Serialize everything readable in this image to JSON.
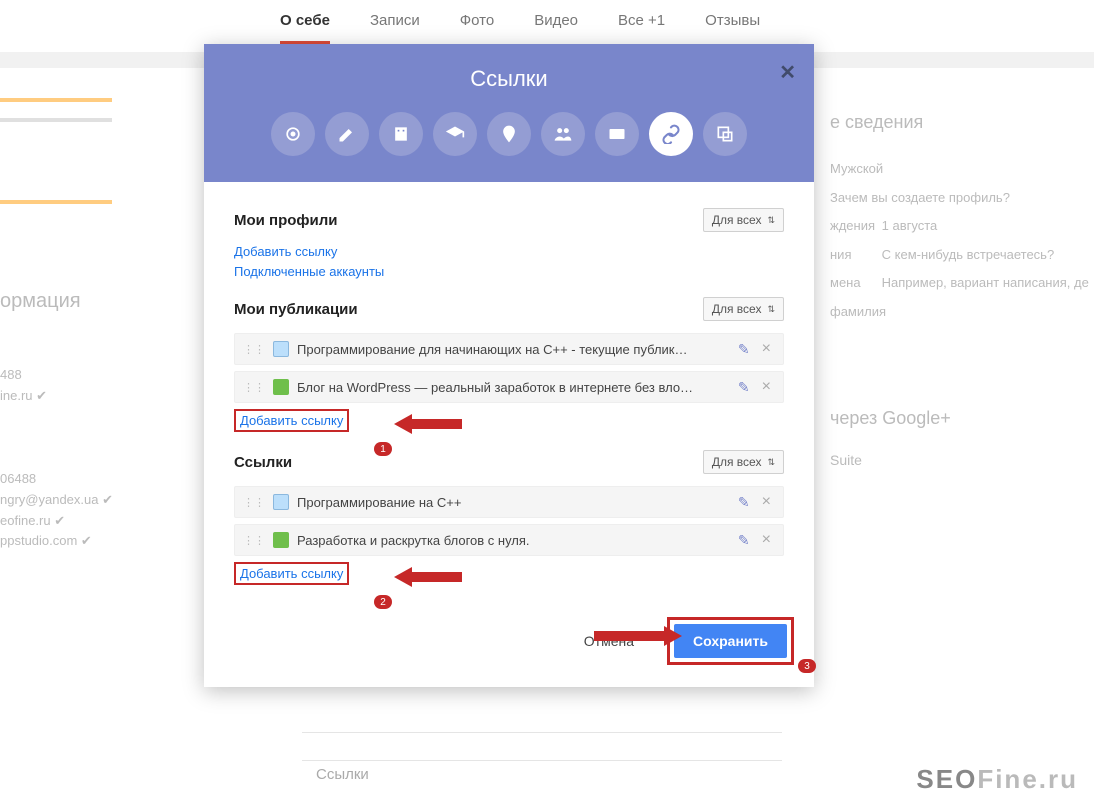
{
  "nav": {
    "items": [
      "О себе",
      "Записи",
      "Фото",
      "Видео",
      "Все +1",
      "Отзывы"
    ],
    "active_index": 0
  },
  "bg": {
    "right_heading": "е сведения",
    "info_heading": "ормация",
    "gender": "Мужской",
    "why": "Зачем вы создаете профиль?",
    "birthday_lbl": "ждения",
    "birthday_val": "1 августа",
    "relation_lbl": "ния",
    "relation_val": "С кем-нибудь встречаетесь?",
    "names_lbl": "мена",
    "names_val": "Например, вариант написания, де фамилия",
    "contacts": [
      "488",
      "ine.ru ✔"
    ],
    "contacts2": [
      "06488",
      "ngry@yandex.ua ✔",
      "eofine.ru ✔",
      "ppstudio.com ✔"
    ],
    "gplus": "через Google+",
    "suite": "Suite",
    "bottom_link": "Ссылки"
  },
  "modal": {
    "title": "Ссылки",
    "close": "✕",
    "icons": [
      "link",
      "pencil",
      "building",
      "graduation",
      "pin",
      "people",
      "id-card",
      "chain",
      "external"
    ],
    "active_icon_index": 7,
    "sections": [
      {
        "title": "Мои профили",
        "visibility": "Для всех",
        "items": [],
        "links": [
          "Добавить ссылку",
          "Подключенные аккаунты"
        ]
      },
      {
        "title": "Мои публикации",
        "visibility": "Для всех",
        "items": [
          {
            "favicon": "cpp",
            "text": "Программирование для начинающих на C++ - текущие публик…"
          },
          {
            "favicon": "wp",
            "text": "Блог на WordPress — реальный заработок в интернете без вло…"
          }
        ],
        "links": [
          "Добавить ссылку"
        ],
        "highlight_link": true,
        "badge": "1"
      },
      {
        "title": "Ссылки",
        "visibility": "Для всех",
        "items": [
          {
            "favicon": "cpp",
            "text": "Программирование на C++"
          },
          {
            "favicon": "wp",
            "text": "Разработка и раскрутка блогов с нуля."
          }
        ],
        "links": [
          "Добавить ссылку"
        ],
        "highlight_link": true,
        "badge": "2"
      }
    ],
    "footer": {
      "cancel": "Отмена",
      "save": "Сохранить",
      "save_badge": "3"
    }
  },
  "watermark": "SEOFine.ru"
}
